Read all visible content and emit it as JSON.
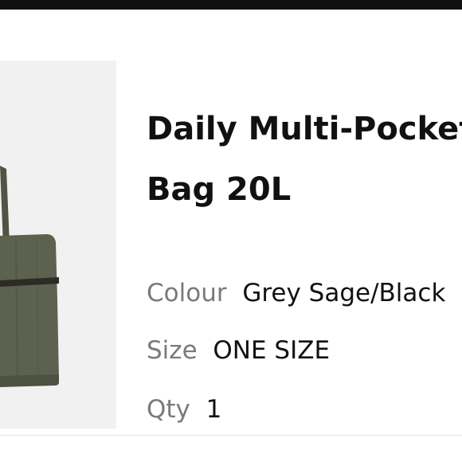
{
  "product": {
    "title_line1": "Daily Multi-Pocket",
    "title_line2": "Bag 20L",
    "colour_label": "Colour",
    "colour_value": "Grey Sage/Black",
    "size_label": "Size",
    "size_value": "ONE SIZE",
    "qty_label": "Qty",
    "qty_value": "1"
  },
  "colors": {
    "bag_primary": "#5c6150",
    "thumb_background": "#f1f1f1"
  }
}
